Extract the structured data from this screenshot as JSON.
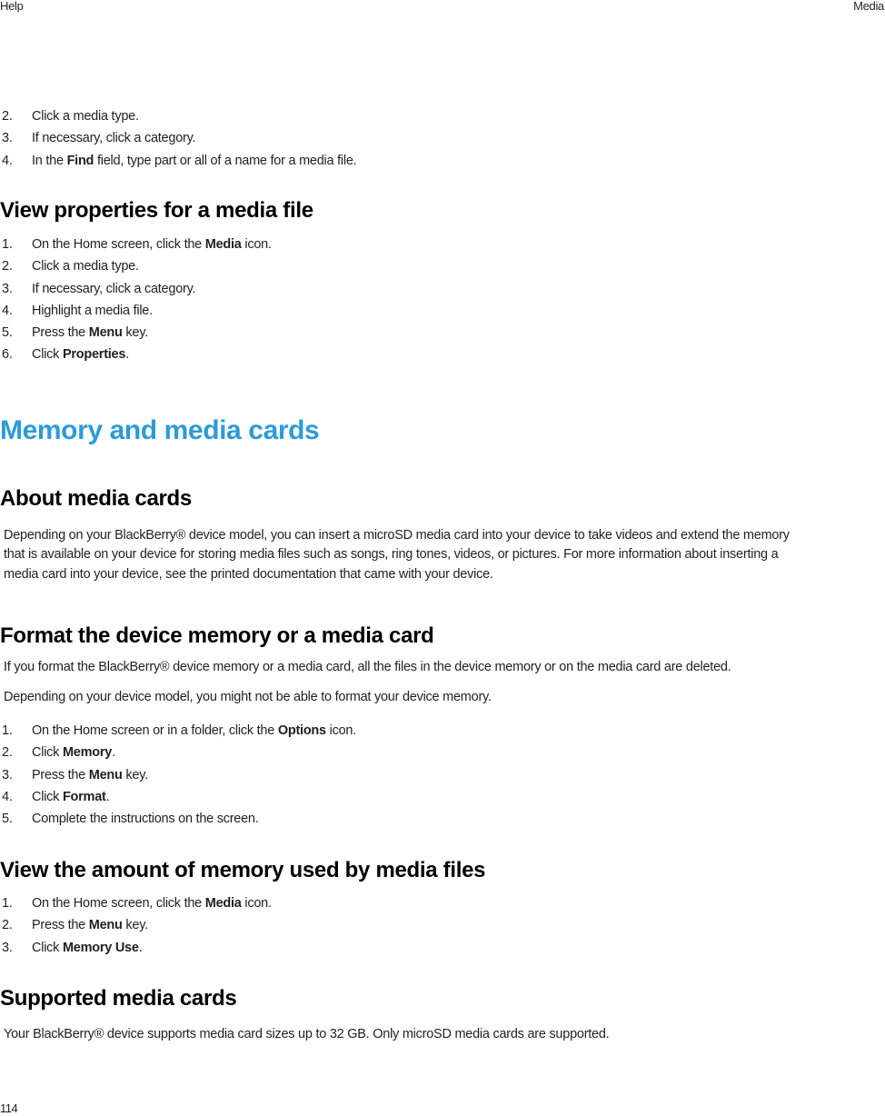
{
  "header": {
    "left": "Help",
    "right": "Media"
  },
  "continued_steps": [
    {
      "num": "2.",
      "pre": "Click a media type.",
      "bold": "",
      "post": ""
    },
    {
      "num": "3.",
      "pre": "If necessary, click a category.",
      "bold": "",
      "post": ""
    },
    {
      "num": "4.",
      "pre": "In the ",
      "bold": "Find",
      "post": " field, type part or all of a name for a media file."
    }
  ],
  "view_properties": {
    "title": "View properties for a media file",
    "steps": [
      {
        "num": "1.",
        "pre": "On the Home screen, click the ",
        "bold": "Media",
        "post": " icon."
      },
      {
        "num": "2.",
        "pre": "Click a media type.",
        "bold": "",
        "post": ""
      },
      {
        "num": "3.",
        "pre": "If necessary, click a category.",
        "bold": "",
        "post": ""
      },
      {
        "num": "4.",
        "pre": "Highlight a media file.",
        "bold": "",
        "post": ""
      },
      {
        "num": "5.",
        "pre": "Press the ",
        "bold": "Menu",
        "post": " key."
      },
      {
        "num": "6.",
        "pre": "Click ",
        "bold": "Properties",
        "post": "."
      }
    ]
  },
  "chapter": {
    "title": "Memory and media cards",
    "accent_color": "#2d9bd7"
  },
  "about_media_cards": {
    "title": "About media cards",
    "lines": [
      "Depending on your BlackBerry® device model, you can insert a microSD media card into your device to take videos and extend the memory",
      "that is available on your device for storing media files such as songs, ring tones, videos, or pictures. For more information about inserting a",
      "media card into your device, see the printed documentation that came with your device."
    ]
  },
  "format_memory": {
    "title": "Format the device memory or a media card",
    "para1": "If you format the BlackBerry® device memory or a media card, all the files in the device memory or on the media card are deleted.",
    "para2": "Depending on your device model, you might not be able to format your device memory.",
    "steps": [
      {
        "num": "1.",
        "pre": "On the Home screen or in a folder, click the ",
        "bold": "Options",
        "post": " icon."
      },
      {
        "num": "2.",
        "pre": "Click ",
        "bold": "Memory",
        "post": "."
      },
      {
        "num": "3.",
        "pre": "Press the ",
        "bold": "Menu",
        "post": " key."
      },
      {
        "num": "4.",
        "pre": "Click ",
        "bold": "Format",
        "post": "."
      },
      {
        "num": "5.",
        "pre": "Complete the instructions on the screen.",
        "bold": "",
        "post": ""
      }
    ]
  },
  "memory_used": {
    "title": "View the amount of memory used by media files",
    "steps": [
      {
        "num": "1.",
        "pre": "On the Home screen, click the ",
        "bold": "Media",
        "post": " icon."
      },
      {
        "num": "2.",
        "pre": "Press the ",
        "bold": "Menu",
        "post": " key."
      },
      {
        "num": "3.",
        "pre": "Click ",
        "bold": "Memory Use",
        "post": "."
      }
    ]
  },
  "supported_cards": {
    "title": "Supported media cards",
    "text": "Your BlackBerry® device supports media card sizes up to 32 GB. Only microSD media cards are supported."
  },
  "footer": {
    "page_number": "114"
  }
}
